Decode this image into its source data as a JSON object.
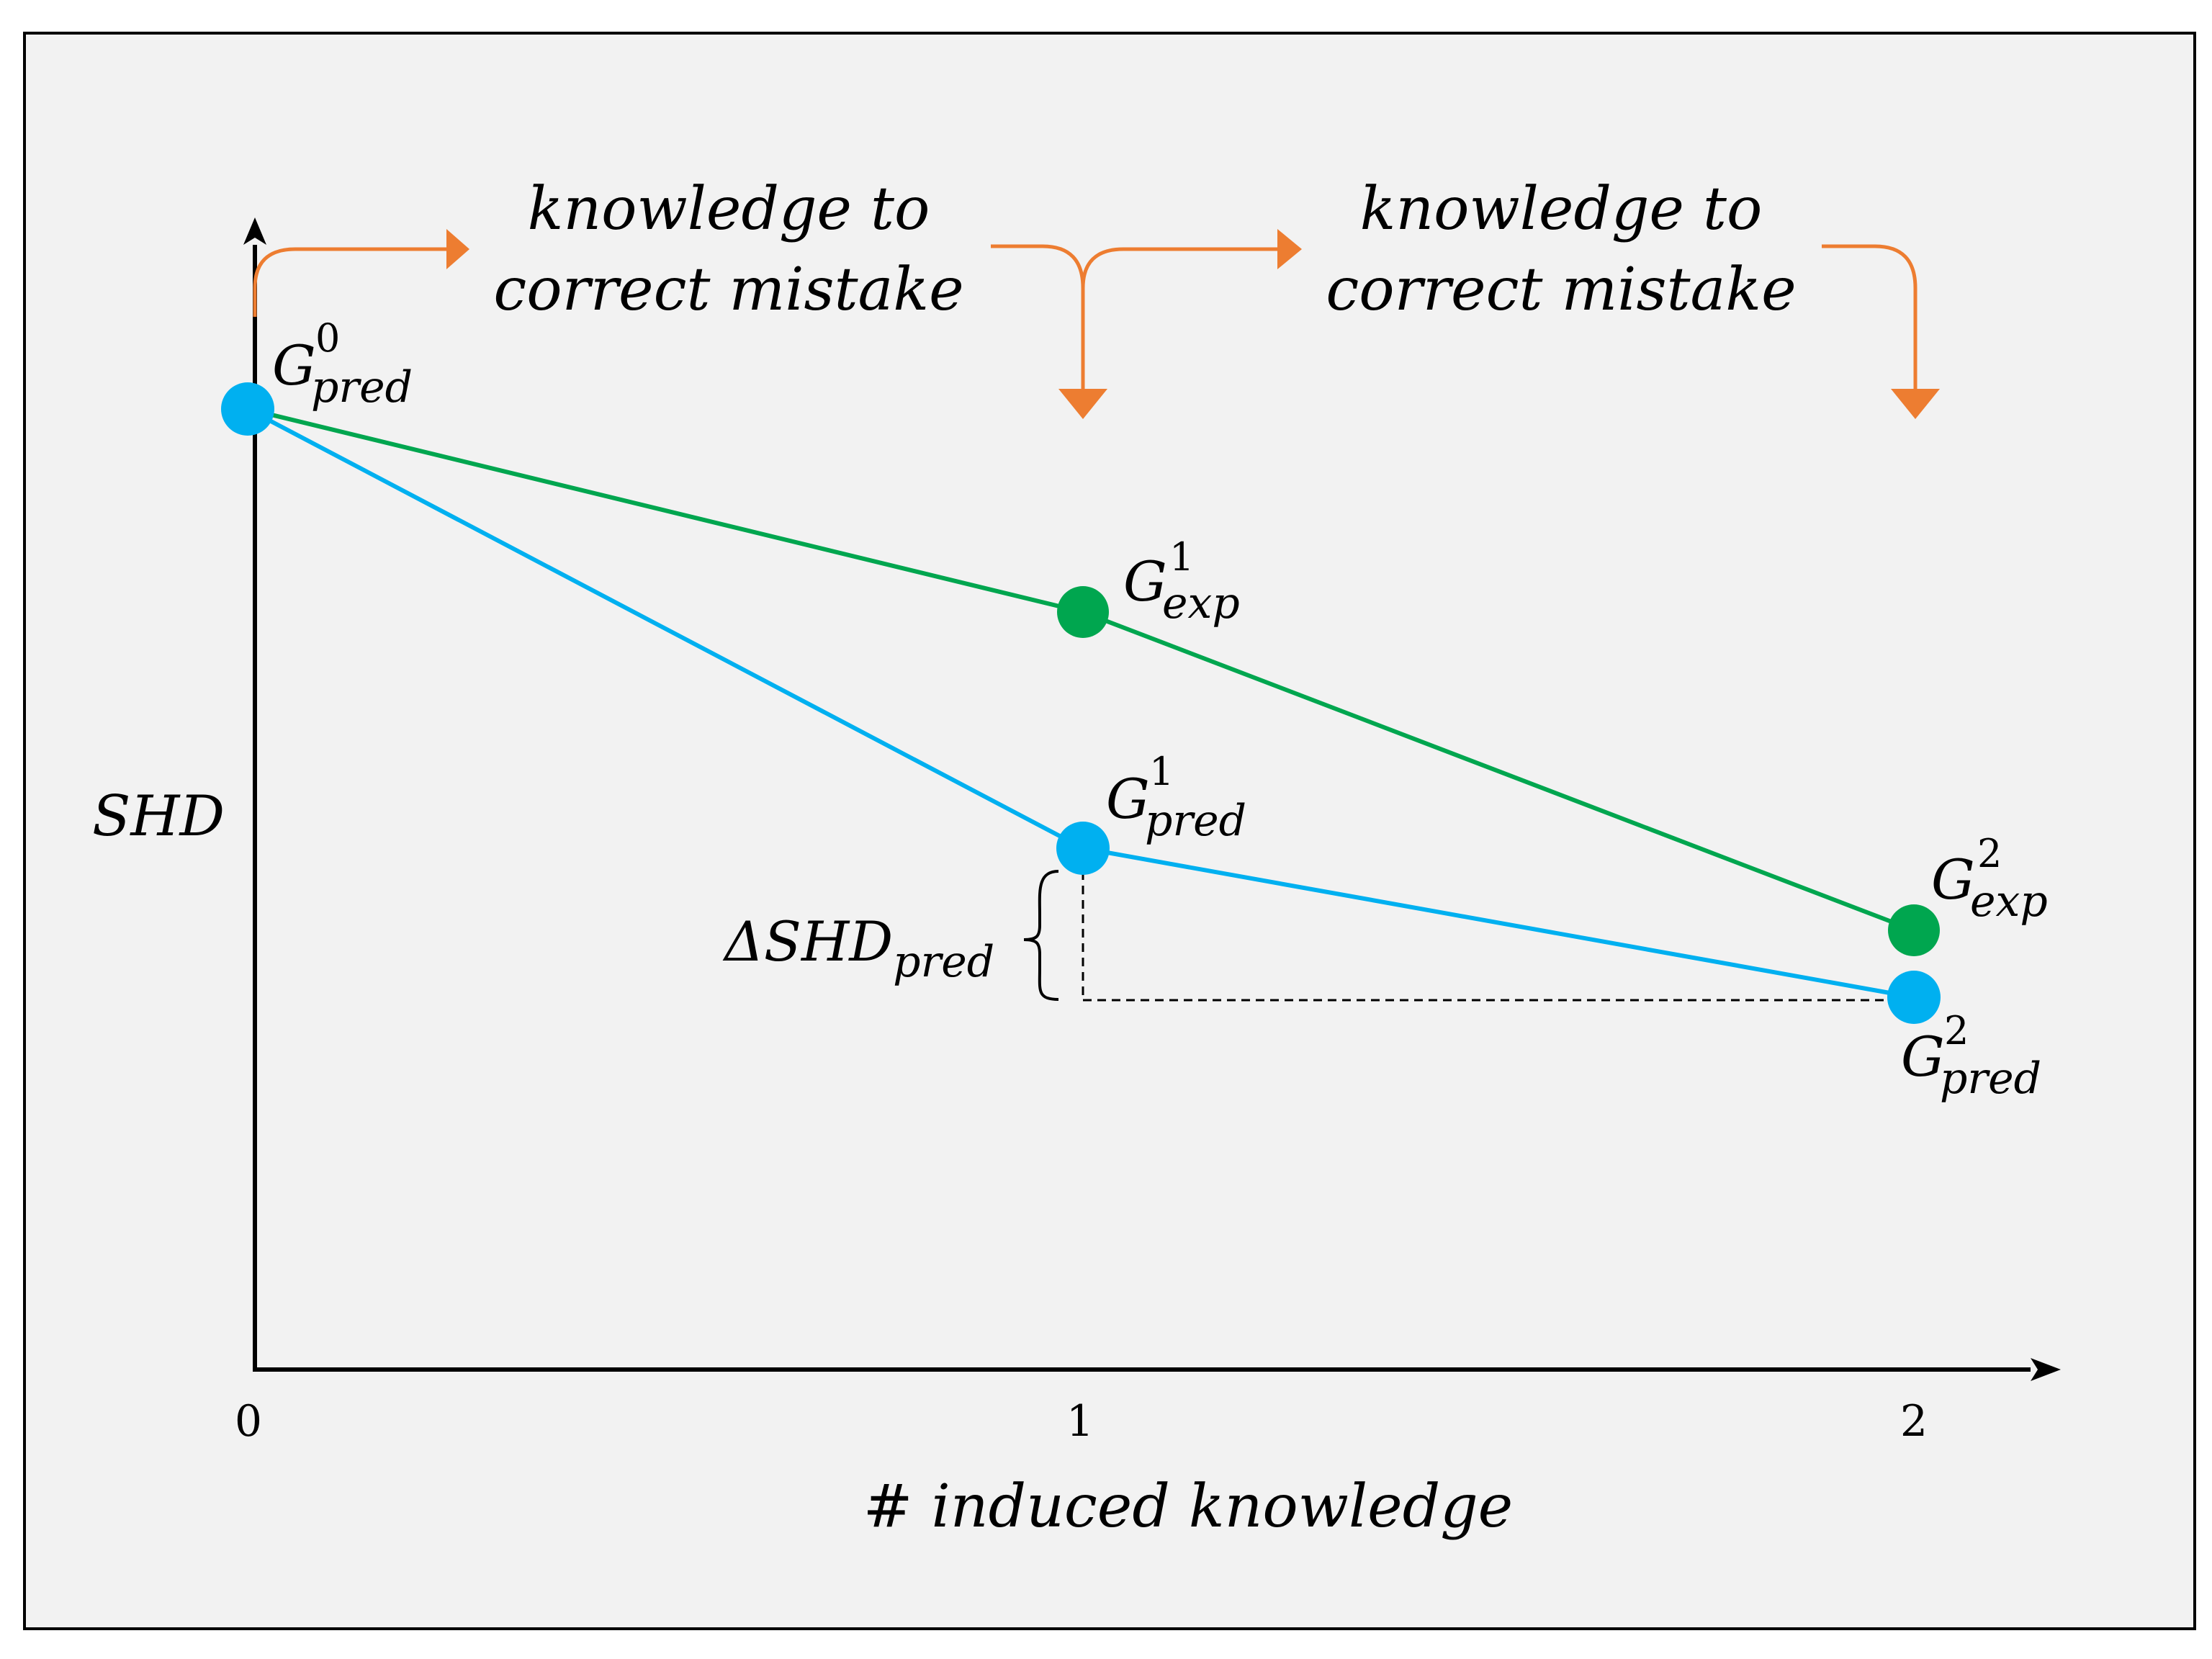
{
  "chart_data": {
    "type": "line",
    "xlabel": "# induced knowledge",
    "ylabel": "SHD",
    "x_ticks": [
      "0",
      "1",
      "2"
    ],
    "y_scale": "unlabeled, SHD decreasing as knowledge is added",
    "series": [
      {
        "id": "pred",
        "color": "#00b0f0",
        "points": [
          {
            "x": 0,
            "y": 0.85,
            "label": {
              "base": "G",
              "sup": "0",
              "sub": "pred"
            }
          },
          {
            "x": 1,
            "y": 0.47,
            "label": {
              "base": "G",
              "sup": "1",
              "sub": "pred"
            }
          },
          {
            "x": 2,
            "y": 0.33,
            "label": {
              "base": "G",
              "sup": "2",
              "sub": "pred"
            }
          }
        ]
      },
      {
        "id": "exp",
        "color": "#00a64f",
        "points": [
          {
            "x": 0,
            "y": 0.85,
            "label": null
          },
          {
            "x": 1,
            "y": 0.68,
            "label": {
              "base": "G",
              "sup": "1",
              "sub": "exp"
            }
          },
          {
            "x": 2,
            "y": 0.39,
            "label": {
              "base": "G",
              "sup": "2",
              "sub": "exp"
            }
          }
        ]
      }
    ],
    "annotations": {
      "delta": {
        "base": "ΔSHD",
        "sub": "pred"
      },
      "step_text_1": [
        "knowledge to",
        "correct mistake"
      ],
      "step_text_2": [
        "knowledge to",
        "correct mistake"
      ]
    }
  },
  "colors": {
    "background": "#f2f2f2",
    "border": "#000000",
    "axis": "#000000",
    "arrow": "#ed7d31"
  }
}
